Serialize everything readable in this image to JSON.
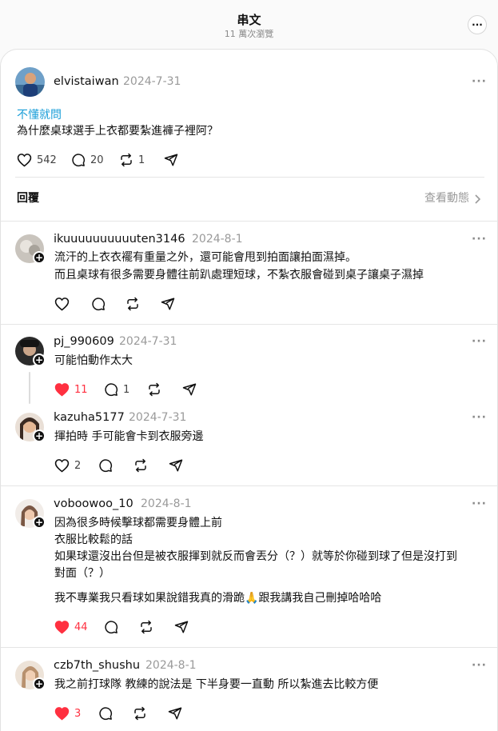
{
  "header": {
    "title": "串文",
    "subtitle": "11 萬次瀏覽"
  },
  "post": {
    "username": "elvistaiwan",
    "date": "2024-7-31",
    "tag": "不懂就問",
    "text": "為什麼桌球選手上衣都要紮進褲子裡阿？",
    "likes": "542",
    "comments": "20",
    "reposts": "1"
  },
  "replies_bar": {
    "label": "回覆",
    "view_activity": "查看動態"
  },
  "replies": [
    {
      "username": "ikuuuuuuuuuuten3146",
      "date": "2024-8-1",
      "lines": [
        "流汗的上衣衣襬有重量之外，還可能會甩到拍面讓拍面濕掉。",
        "而且桌球有很多需要身體往前趴處理短球，不紮衣服會碰到桌子讓桌子濕掉"
      ],
      "likes": "",
      "comments": "",
      "reposts": ""
    },
    {
      "username": "pj_990609",
      "date": "2024-7-31",
      "lines": [
        "可能怕動作太大"
      ],
      "likes": "11",
      "comments": "1",
      "reposts": ""
    },
    {
      "username": "kazuha5177",
      "date": "2024-7-31",
      "lines": [
        "揮拍時 手可能會卡到衣服旁邊"
      ],
      "likes": "2",
      "comments": "",
      "reposts": ""
    },
    {
      "username": "voboowoo_10",
      "date": "2024-8-1",
      "lines": [
        "因為很多時候擊球都需要身體上前",
        "衣服比較鬆的話",
        "如果球還沒出台但是被衣服揮到就反而會丟分（？）就等於你碰到球了但是沒打到",
        "對面（？）",
        "我不專業我只看球如果說錯我真的滑跪🙏跟我講我自己刪掉哈哈哈"
      ],
      "likes": "44",
      "comments": "",
      "reposts": ""
    },
    {
      "username": "czb7th_shushu",
      "date": "2024-8-1",
      "lines": [
        "我之前打球隊 教練的說法是 下半身要一直動 所以紮進去比較方便"
      ],
      "likes": "3",
      "comments": "",
      "reposts": ""
    }
  ],
  "colors": {
    "liked": "#ff3040",
    "tag": "#1a9ed8",
    "muted": "#9a9a9a"
  },
  "icons": [
    "more-icon",
    "heart-icon",
    "comment-icon",
    "repost-icon",
    "share-icon",
    "chevron-right-icon",
    "follow-plus-icon"
  ]
}
